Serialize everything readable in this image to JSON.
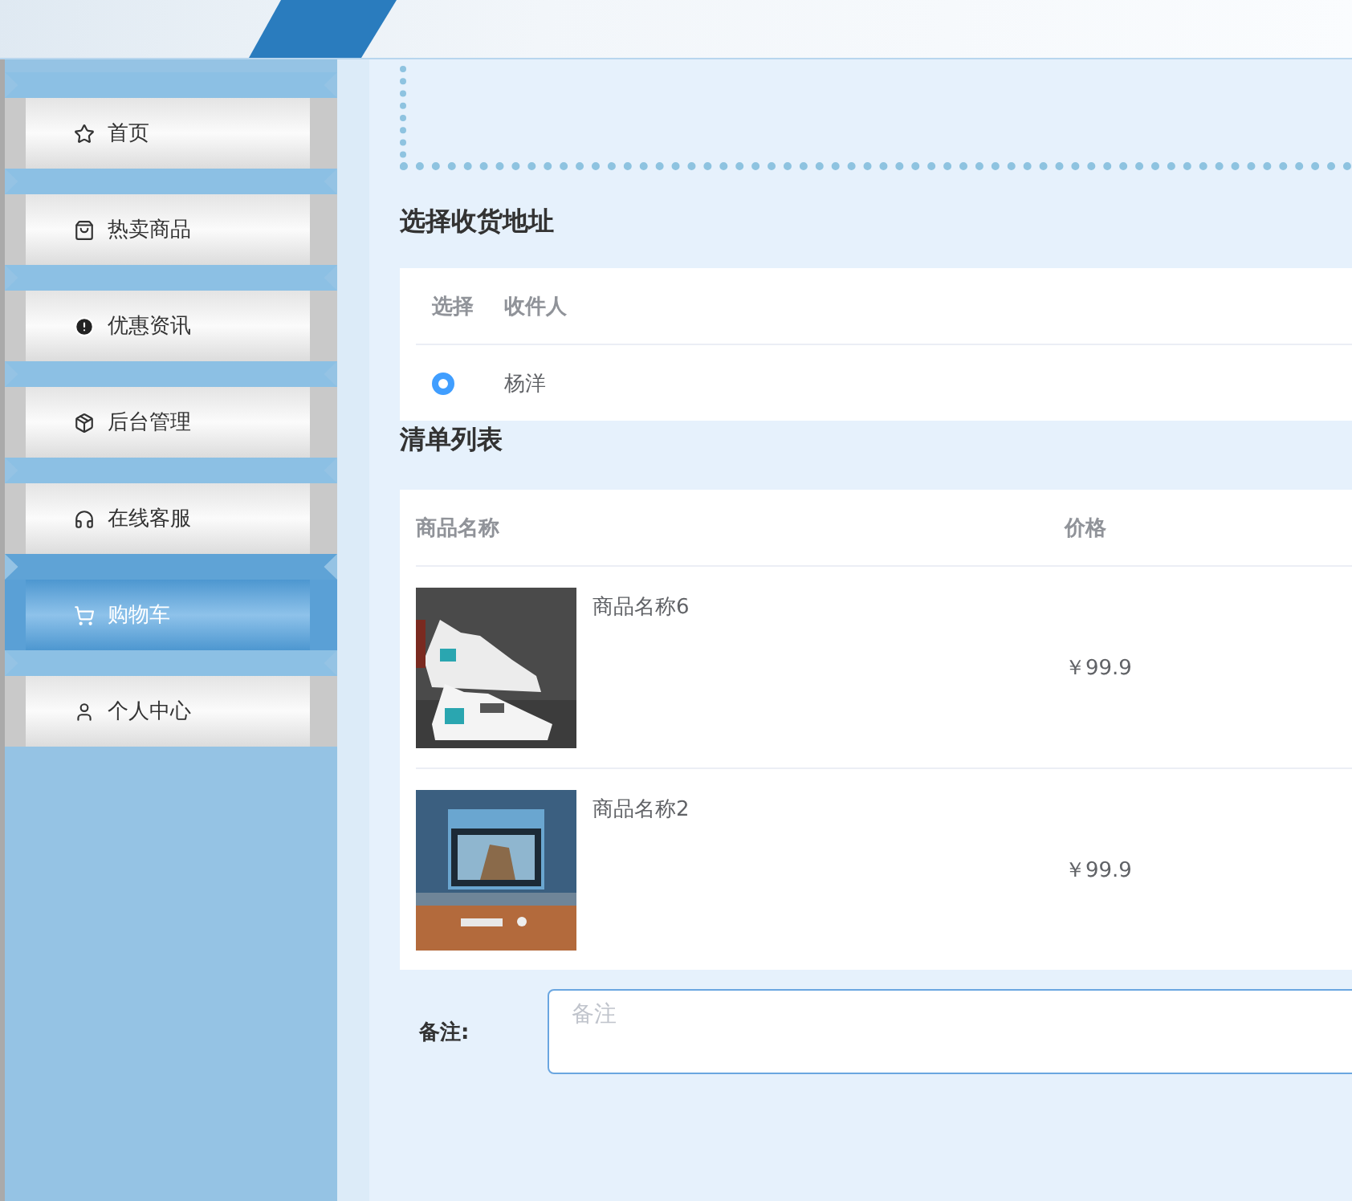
{
  "sidebar": {
    "items": [
      {
        "label": "首页",
        "selected": false
      },
      {
        "label": "热卖商品",
        "selected": false
      },
      {
        "label": "优惠资讯",
        "selected": false
      },
      {
        "label": "后台管理",
        "selected": false
      },
      {
        "label": "在线客服",
        "selected": false
      },
      {
        "label": "购物车",
        "selected": true
      },
      {
        "label": "个人中心",
        "selected": false
      }
    ]
  },
  "address": {
    "title": "选择收货地址",
    "columns": [
      "选择",
      "收件人"
    ],
    "rows": [
      {
        "name": "杨洋",
        "selected": true
      }
    ]
  },
  "cart": {
    "title": "清单列表",
    "columns": [
      "商品名称",
      "价格"
    ],
    "rows": [
      {
        "name": "商品名称6",
        "price": "￥99.9"
      },
      {
        "name": "商品名称2",
        "price": "￥99.9"
      }
    ]
  },
  "remark": {
    "label": "备注:",
    "placeholder": "备注"
  }
}
